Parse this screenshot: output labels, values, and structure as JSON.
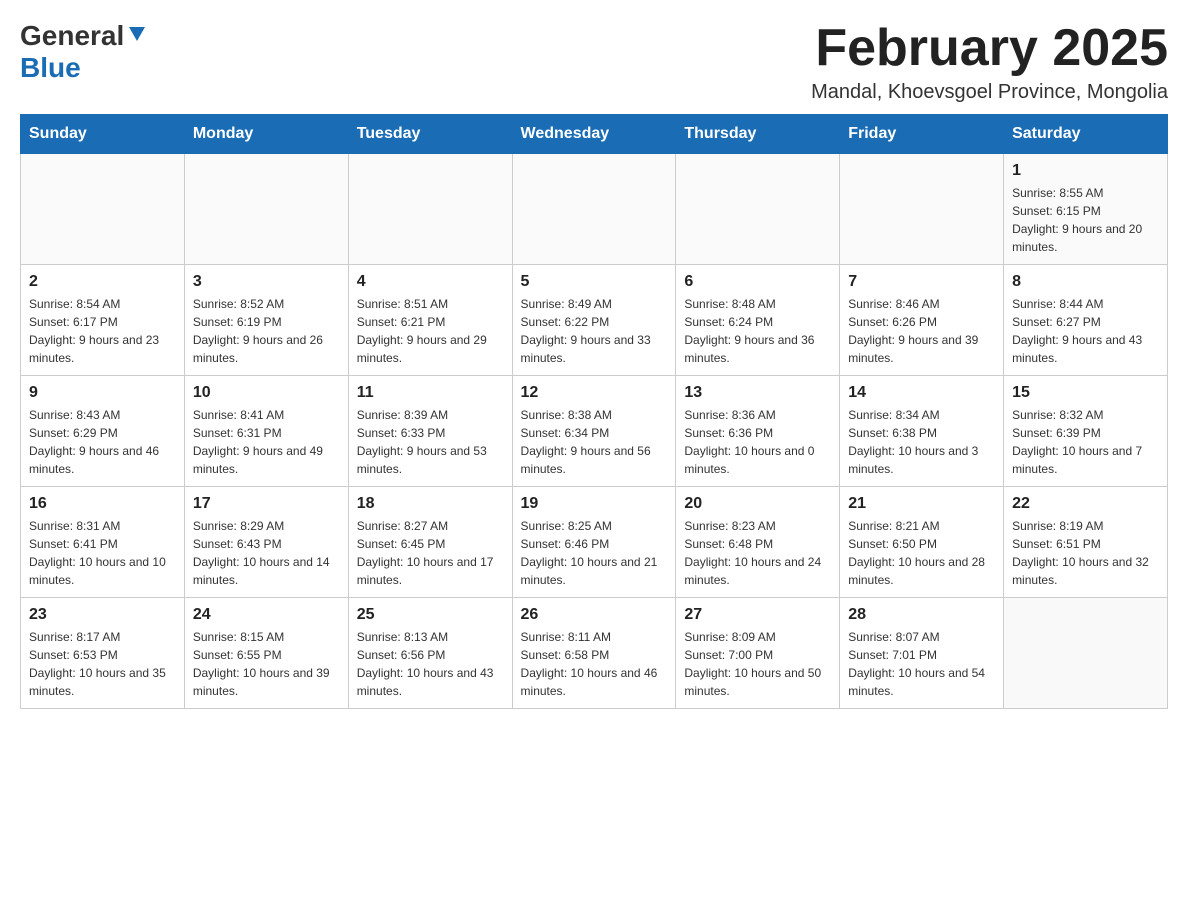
{
  "header": {
    "logo": {
      "general": "General",
      "blue": "Blue",
      "aria": "GeneralBlue logo"
    },
    "title": "February 2025",
    "location": "Mandal, Khoevsgoel Province, Mongolia"
  },
  "weekdays": [
    "Sunday",
    "Monday",
    "Tuesday",
    "Wednesday",
    "Thursday",
    "Friday",
    "Saturday"
  ],
  "weeks": [
    [
      {
        "day": "",
        "info": ""
      },
      {
        "day": "",
        "info": ""
      },
      {
        "day": "",
        "info": ""
      },
      {
        "day": "",
        "info": ""
      },
      {
        "day": "",
        "info": ""
      },
      {
        "day": "",
        "info": ""
      },
      {
        "day": "1",
        "info": "Sunrise: 8:55 AM\nSunset: 6:15 PM\nDaylight: 9 hours and 20 minutes."
      }
    ],
    [
      {
        "day": "2",
        "info": "Sunrise: 8:54 AM\nSunset: 6:17 PM\nDaylight: 9 hours and 23 minutes."
      },
      {
        "day": "3",
        "info": "Sunrise: 8:52 AM\nSunset: 6:19 PM\nDaylight: 9 hours and 26 minutes."
      },
      {
        "day": "4",
        "info": "Sunrise: 8:51 AM\nSunset: 6:21 PM\nDaylight: 9 hours and 29 minutes."
      },
      {
        "day": "5",
        "info": "Sunrise: 8:49 AM\nSunset: 6:22 PM\nDaylight: 9 hours and 33 minutes."
      },
      {
        "day": "6",
        "info": "Sunrise: 8:48 AM\nSunset: 6:24 PM\nDaylight: 9 hours and 36 minutes."
      },
      {
        "day": "7",
        "info": "Sunrise: 8:46 AM\nSunset: 6:26 PM\nDaylight: 9 hours and 39 minutes."
      },
      {
        "day": "8",
        "info": "Sunrise: 8:44 AM\nSunset: 6:27 PM\nDaylight: 9 hours and 43 minutes."
      }
    ],
    [
      {
        "day": "9",
        "info": "Sunrise: 8:43 AM\nSunset: 6:29 PM\nDaylight: 9 hours and 46 minutes."
      },
      {
        "day": "10",
        "info": "Sunrise: 8:41 AM\nSunset: 6:31 PM\nDaylight: 9 hours and 49 minutes."
      },
      {
        "day": "11",
        "info": "Sunrise: 8:39 AM\nSunset: 6:33 PM\nDaylight: 9 hours and 53 minutes."
      },
      {
        "day": "12",
        "info": "Sunrise: 8:38 AM\nSunset: 6:34 PM\nDaylight: 9 hours and 56 minutes."
      },
      {
        "day": "13",
        "info": "Sunrise: 8:36 AM\nSunset: 6:36 PM\nDaylight: 10 hours and 0 minutes."
      },
      {
        "day": "14",
        "info": "Sunrise: 8:34 AM\nSunset: 6:38 PM\nDaylight: 10 hours and 3 minutes."
      },
      {
        "day": "15",
        "info": "Sunrise: 8:32 AM\nSunset: 6:39 PM\nDaylight: 10 hours and 7 minutes."
      }
    ],
    [
      {
        "day": "16",
        "info": "Sunrise: 8:31 AM\nSunset: 6:41 PM\nDaylight: 10 hours and 10 minutes."
      },
      {
        "day": "17",
        "info": "Sunrise: 8:29 AM\nSunset: 6:43 PM\nDaylight: 10 hours and 14 minutes."
      },
      {
        "day": "18",
        "info": "Sunrise: 8:27 AM\nSunset: 6:45 PM\nDaylight: 10 hours and 17 minutes."
      },
      {
        "day": "19",
        "info": "Sunrise: 8:25 AM\nSunset: 6:46 PM\nDaylight: 10 hours and 21 minutes."
      },
      {
        "day": "20",
        "info": "Sunrise: 8:23 AM\nSunset: 6:48 PM\nDaylight: 10 hours and 24 minutes."
      },
      {
        "day": "21",
        "info": "Sunrise: 8:21 AM\nSunset: 6:50 PM\nDaylight: 10 hours and 28 minutes."
      },
      {
        "day": "22",
        "info": "Sunrise: 8:19 AM\nSunset: 6:51 PM\nDaylight: 10 hours and 32 minutes."
      }
    ],
    [
      {
        "day": "23",
        "info": "Sunrise: 8:17 AM\nSunset: 6:53 PM\nDaylight: 10 hours and 35 minutes."
      },
      {
        "day": "24",
        "info": "Sunrise: 8:15 AM\nSunset: 6:55 PM\nDaylight: 10 hours and 39 minutes."
      },
      {
        "day": "25",
        "info": "Sunrise: 8:13 AM\nSunset: 6:56 PM\nDaylight: 10 hours and 43 minutes."
      },
      {
        "day": "26",
        "info": "Sunrise: 8:11 AM\nSunset: 6:58 PM\nDaylight: 10 hours and 46 minutes."
      },
      {
        "day": "27",
        "info": "Sunrise: 8:09 AM\nSunset: 7:00 PM\nDaylight: 10 hours and 50 minutes."
      },
      {
        "day": "28",
        "info": "Sunrise: 8:07 AM\nSunset: 7:01 PM\nDaylight: 10 hours and 54 minutes."
      },
      {
        "day": "",
        "info": ""
      }
    ]
  ]
}
